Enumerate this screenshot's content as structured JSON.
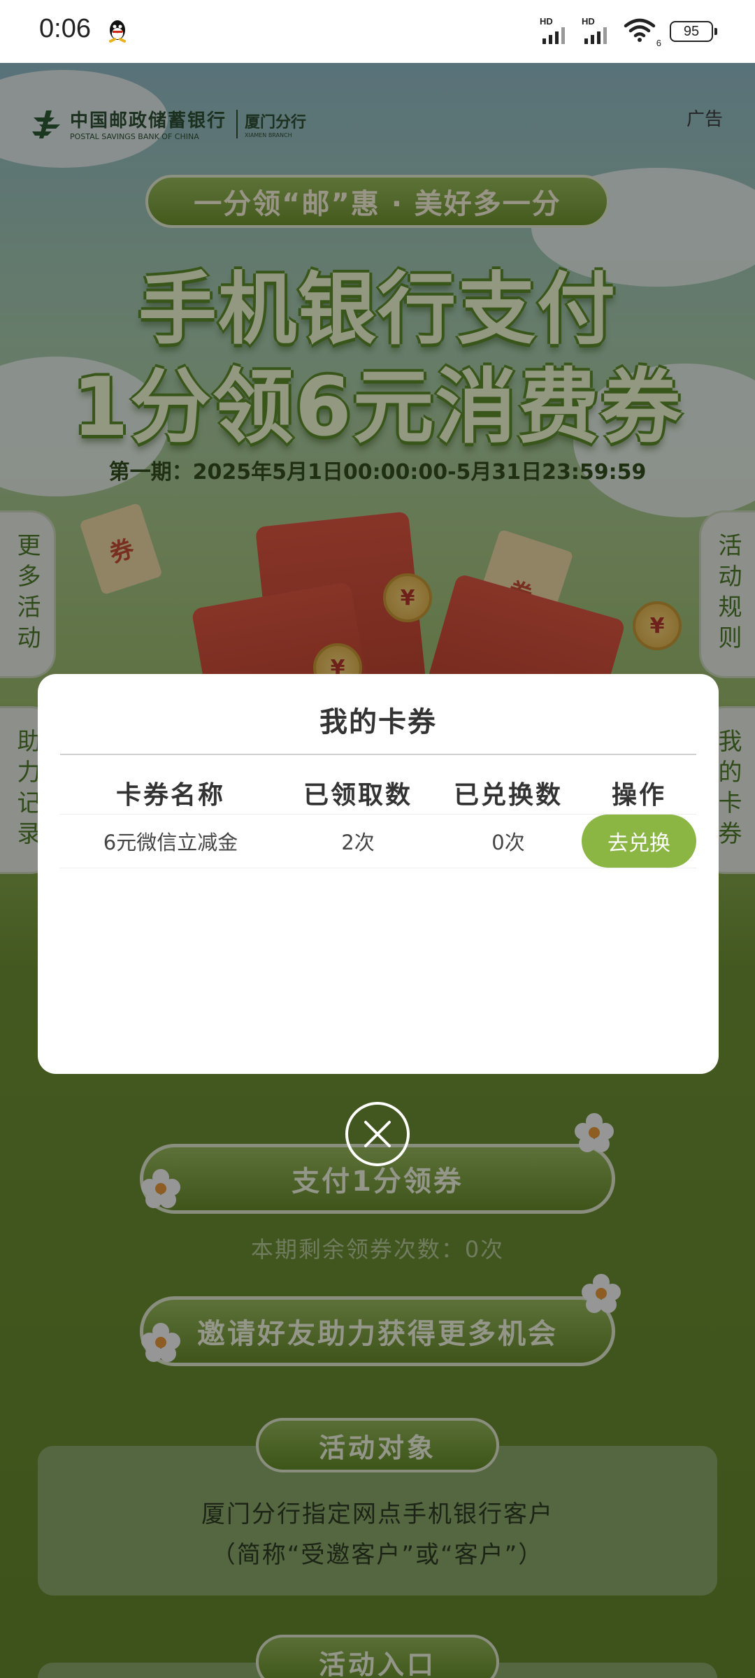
{
  "status_bar": {
    "time": "0:06",
    "signal1_label": "HD",
    "signal2_label": "HD",
    "wifi_sub": "6",
    "battery": "95"
  },
  "header": {
    "bank_name_cn": "中国邮政储蓄银行",
    "bank_name_en": "POSTAL SAVINGS BANK OF CHINA",
    "branch_cn": "厦门分行",
    "branch_en": "XIAMEN BRANCH",
    "ad_label": "广告"
  },
  "banner": {
    "slogan": "一分领“邮”惠 · 美好多一分",
    "headline_line1": "手机银行支付",
    "headline_line2": "1分领6元消费券",
    "period": "第一期：2025年5月1日00:00:00-5月31日23:59:59",
    "ticket_text": "券",
    "coin_symbol": "¥"
  },
  "side_tabs": {
    "more_activities": "更多活动",
    "activity_rules": "活动规则",
    "help_records": "助力记录",
    "my_coupons": "我的卡券"
  },
  "actions": {
    "pay_coupon": "支付1分领券",
    "remaining": "本期剩余领券次数：0次",
    "invite": "邀请好友助力获得更多机会"
  },
  "sections": {
    "target_title": "活动对象",
    "target_line1": "厦门分行指定网点手机银行客户",
    "target_line2": "（简称“受邀客户”或“客户”）",
    "entry_title": "活动入口"
  },
  "modal": {
    "title": "我的卡券",
    "columns": [
      "卡券名称",
      "已领取数",
      "已兑换数",
      "操作"
    ],
    "rows": [
      {
        "name": "6元微信立减金",
        "received": "2次",
        "redeemed": "0次",
        "action": "去兑换"
      }
    ]
  },
  "colors": {
    "accent_green": "#8bb644",
    "modal_bg": "#ffffff",
    "overlay": "rgba(0,0,0,0.38)"
  }
}
